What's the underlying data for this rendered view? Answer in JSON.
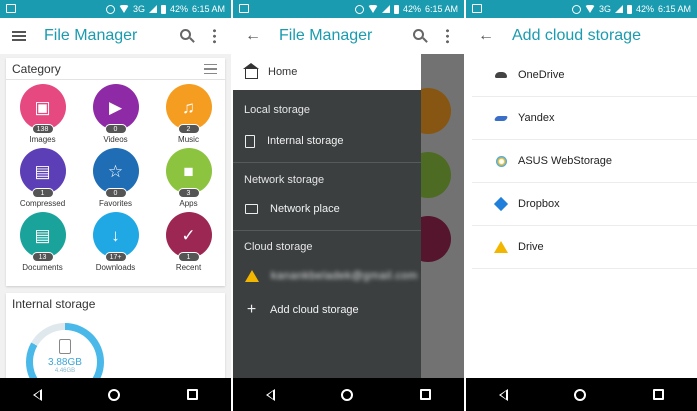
{
  "status_bar": {
    "network": "3G",
    "battery": "42%",
    "time": "6:15 AM"
  },
  "screen1": {
    "app_title": "File Manager",
    "category_title": "Category",
    "categories": [
      {
        "label": "Images",
        "count": "138",
        "color": "#e64980",
        "icon": "image-icon"
      },
      {
        "label": "Videos",
        "count": "0",
        "color": "#8e2aa6",
        "icon": "video-icon"
      },
      {
        "label": "Music",
        "count": "2",
        "color": "#f59d21",
        "icon": "music-icon"
      },
      {
        "label": "Compressed",
        "count": "1",
        "color": "#5c3fb6",
        "icon": "archive-icon"
      },
      {
        "label": "Favorites",
        "count": "0",
        "color": "#1e6db5",
        "icon": "star-icon"
      },
      {
        "label": "Apps",
        "count": "3",
        "color": "#8cc43f",
        "icon": "android-icon"
      },
      {
        "label": "Documents",
        "count": "13",
        "color": "#1aa39a",
        "icon": "document-icon"
      },
      {
        "label": "Downloads",
        "count": "17+",
        "color": "#1fa8e4",
        "icon": "download-icon"
      },
      {
        "label": "Recent",
        "count": "1",
        "color": "#9c2752",
        "icon": "clock-icon"
      }
    ],
    "internal_storage": {
      "title": "Internal storage",
      "used": "3.88GB",
      "total": "4.46GB"
    }
  },
  "screen2": {
    "app_title": "File Manager",
    "drawer": {
      "home": "Home",
      "local_storage": "Local storage",
      "internal_storage": "Internal storage",
      "network_storage": "Network storage",
      "network_place": "Network place",
      "cloud_storage": "Cloud storage",
      "account": "kanankbeladek@gmail.com",
      "add_cloud": "Add cloud storage"
    }
  },
  "screen3": {
    "title": "Add cloud storage",
    "services": [
      {
        "label": "OneDrive",
        "icon": "onedrive-icon"
      },
      {
        "label": "Yandex",
        "icon": "yandex-icon"
      },
      {
        "label": "ASUS WebStorage",
        "icon": "asus-webstorage-icon"
      },
      {
        "label": "Dropbox",
        "icon": "dropbox-icon"
      },
      {
        "label": "Drive",
        "icon": "google-drive-icon"
      }
    ]
  },
  "colors": {
    "accent": "#1a9baf",
    "status_bar": "#1a9baf",
    "drawer_bg": "#3b3f40",
    "nav_bar": "#000000"
  }
}
